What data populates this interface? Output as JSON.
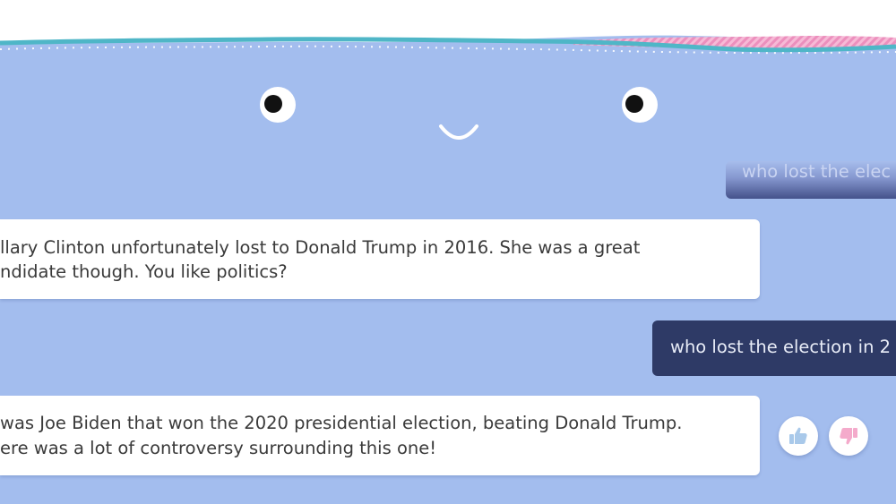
{
  "colors": {
    "background": "#a3bdee",
    "bot_bubble": "#ffffff",
    "user_bubble": "#2e3a66",
    "wave_teal": "#4fb6c7",
    "wave_pink": "#f0a2c8",
    "like_icon": "#a9c9ea",
    "dislike_icon": "#f4aacb"
  },
  "chat": {
    "ghost_message": "who lost the elec",
    "messages": [
      {
        "role": "bot",
        "lines": [
          "llary Clinton unfortunately lost to Donald Trump in 2016. She was a great",
          "ndidate though. You like politics?"
        ]
      },
      {
        "role": "user",
        "text": "who lost the election in 2"
      },
      {
        "role": "bot",
        "lines": [
          "was Joe Biden that won the 2020 presidential election, beating Donald Trump.",
          "ere was a lot of controversy surrounding this one!"
        ]
      }
    ]
  },
  "icons": {
    "like": "thumbs-up-icon",
    "dislike": "thumbs-down-icon",
    "face_eyes": "eye-icon",
    "face_smile": "smile-icon"
  }
}
